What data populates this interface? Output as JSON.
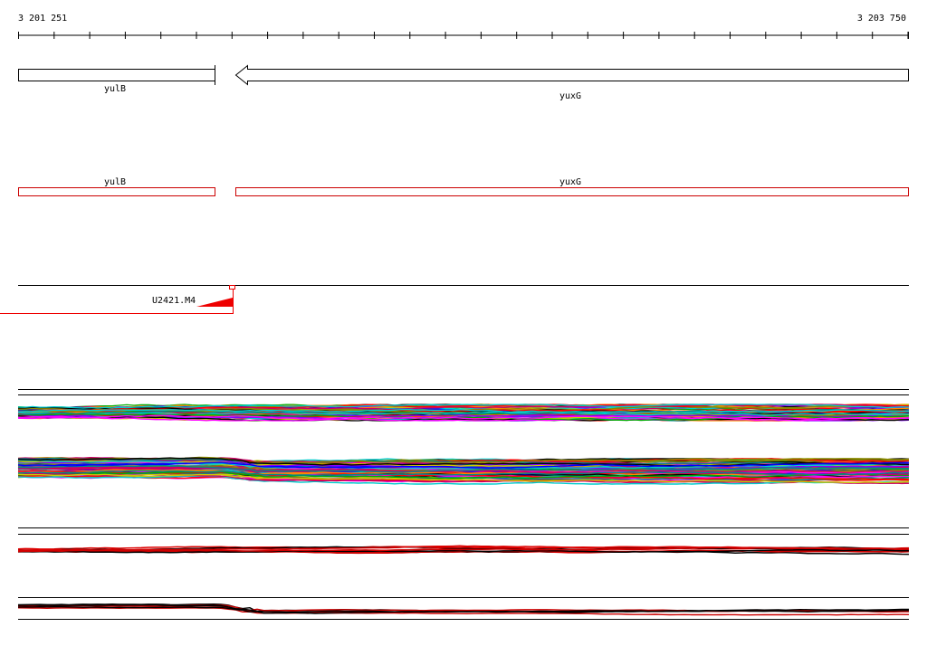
{
  "ruler": {
    "start_label": "3 201 251",
    "end_label": "3 203 750"
  },
  "genes": [
    {
      "name": "yulB",
      "strand": "forward"
    },
    {
      "name": "yuxG",
      "strand": "reverse"
    }
  ],
  "annotation_track": {
    "features": [
      {
        "name": "yulB"
      },
      {
        "name": "yuxG"
      }
    ]
  },
  "promoter": {
    "name": "U2421.M4"
  },
  "colors": {
    "gene_outline": "#000000",
    "annotation_outline": "#cc0000",
    "promoter_fill": "#ee0000",
    "profile_palette": [
      "#ff0000",
      "#00aa00",
      "#0000ff",
      "#ff00ff",
      "#00cccc",
      "#cccc00",
      "#ff8800",
      "#8800ff",
      "#008888",
      "#888800",
      "#000000",
      "#cc0066"
    ]
  }
}
